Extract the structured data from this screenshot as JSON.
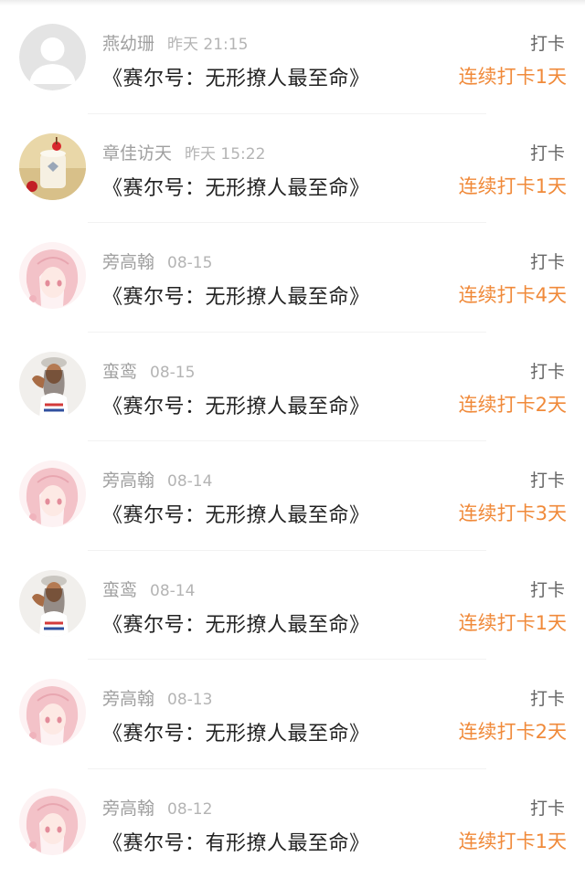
{
  "colors": {
    "streak": "#f08a3a",
    "name": "#a0a0a0",
    "title": "#222222"
  },
  "checkins": [
    {
      "name": "燕幼珊",
      "time": "昨天 21:15",
      "book": "《赛尔号：无形撩人最至命》",
      "action": "打卡",
      "streak": "连续打卡1天",
      "avatar": "default-avatar-icon"
    },
    {
      "name": "章佳访天",
      "time": "昨天 15:22",
      "book": "《赛尔号：无形撩人最至命》",
      "action": "打卡",
      "streak": "连续打卡1天",
      "avatar": "drink-photo-avatar"
    },
    {
      "name": "旁高翰",
      "time": "08-15",
      "book": "《赛尔号：无形撩人最至命》",
      "action": "打卡",
      "streak": "连续打卡4天",
      "avatar": "anime-girl-avatar"
    },
    {
      "name": "蛮鸾",
      "time": "08-15",
      "book": "《赛尔号：无形撩人最至命》",
      "action": "打卡",
      "streak": "连续打卡2天",
      "avatar": "woman-photo-avatar"
    },
    {
      "name": "旁高翰",
      "time": "08-14",
      "book": "《赛尔号：无形撩人最至命》",
      "action": "打卡",
      "streak": "连续打卡3天",
      "avatar": "anime-girl-avatar"
    },
    {
      "name": "蛮鸾",
      "time": "08-14",
      "book": "《赛尔号：无形撩人最至命》",
      "action": "打卡",
      "streak": "连续打卡1天",
      "avatar": "woman-photo-avatar"
    },
    {
      "name": "旁高翰",
      "time": "08-13",
      "book": "《赛尔号：无形撩人最至命》",
      "action": "打卡",
      "streak": "连续打卡2天",
      "avatar": "anime-girl-avatar"
    },
    {
      "name": "旁高翰",
      "time": "08-12",
      "book": "《赛尔号：有形撩人最至命》",
      "action": "打卡",
      "streak": "连续打卡1天",
      "avatar": "anime-girl-avatar"
    }
  ]
}
